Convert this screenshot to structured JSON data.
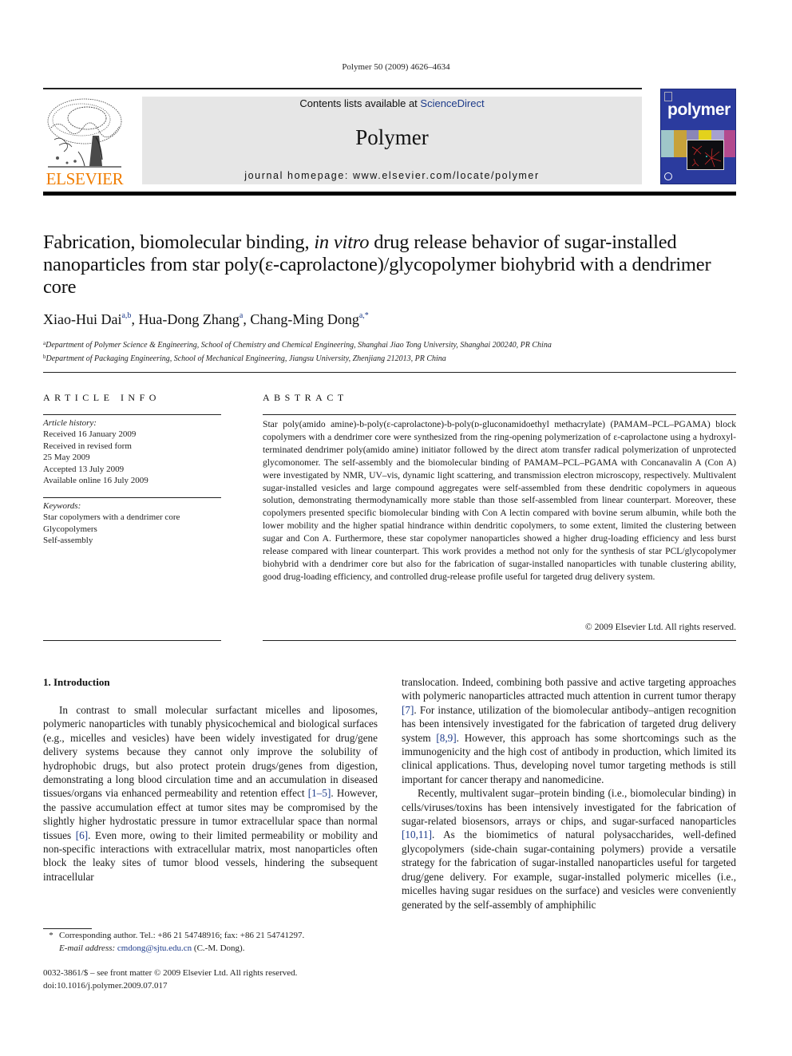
{
  "header": {
    "journal_ref": "Polymer 50 (2009) 4626–4634",
    "contents_prefix": "Contents lists available at ",
    "contents_link": "ScienceDirect",
    "journal_name": "Polymer",
    "homepage": "journal homepage: www.elsevier.com/locate/polymer",
    "publisher_wordmark": "ELSEVIER",
    "cover_title": "polymer",
    "colors": {
      "publisher_orange": "#f07d00",
      "link_blue": "#1d3b8a",
      "cover_blue": "#2b3b9e",
      "masthead_gray": "#e6e6e6"
    }
  },
  "article": {
    "title_part1": "Fabrication, biomolecular binding, ",
    "title_italic": "in vitro",
    "title_part2": " drug release behavior of sugar-installed nanoparticles from star poly(ε-caprolactone)/glycopolymer biohybrid with a dendrimer core",
    "authors": [
      {
        "name": "Xiao-Hui Dai",
        "sup": "a,b",
        "sep": ", "
      },
      {
        "name": "Hua-Dong Zhang",
        "sup": "a",
        "sep": ", "
      },
      {
        "name": "Chang-Ming Dong",
        "sup": "a,*",
        "sep": ""
      }
    ],
    "affiliations": [
      {
        "mark": "a",
        "text": "Department of Polymer Science & Engineering, School of Chemistry and Chemical Engineering, Shanghai Jiao Tong University, Shanghai 200240, PR China"
      },
      {
        "mark": "b",
        "text": "Department of Packaging Engineering, School of Mechanical Engineering, Jiangsu University, Zhenjiang 212013, PR China"
      }
    ]
  },
  "article_info": {
    "heading": "ARTICLE INFO",
    "history_label": "Article history:",
    "history": [
      "Received 16 January 2009",
      "Received in revised form",
      "25 May 2009",
      "Accepted 13 July 2009",
      "Available online 16 July 2009"
    ],
    "keywords_label": "Keywords:",
    "keywords": [
      "Star copolymers with a dendrimer core",
      "Glycopolymers",
      "Self-assembly"
    ]
  },
  "abstract": {
    "heading": "ABSTRACT",
    "body": "Star poly(amido amine)-b-poly(ε-caprolactone)-b-poly(ᴅ-gluconamidoethyl methacrylate) (PAMAM–PCL–PGAMA) block copolymers with a dendrimer core were synthesized from the ring-opening polymerization of ε-caprolactone using a hydroxyl-terminated dendrimer poly(amido amine) initiator followed by the direct atom transfer radical polymerization of unprotected glycomonomer. The self-assembly and the biomolecular binding of PAMAM–PCL–PGAMA with Concanavalin A (Con A) were investigated by NMR, UV–vis, dynamic light scattering, and transmission electron microscopy, respectively. Multivalent sugar-installed vesicles and large compound aggregates were self-assembled from these dendritic copolymers in aqueous solution, demonstrating thermodynamically more stable than those self-assembled from linear counterpart. Moreover, these copolymers presented specific biomolecular binding with Con A lectin compared with bovine serum albumin, while both the lower mobility and the higher spatial hindrance within dendritic copolymers, to some extent, limited the clustering between sugar and Con A. Furthermore, these star copolymer nanoparticles showed a higher drug-loading efficiency and less burst release compared with linear counterpart. This work provides a method not only for the synthesis of star PCL/glycopolymer biohybrid with a dendrimer core but also for the fabrication of sugar-installed nanoparticles with tunable clustering ability, good drug-loading efficiency, and controlled drug-release profile useful for targeted drug delivery system.",
    "copyright": "© 2009 Elsevier Ltd. All rights reserved."
  },
  "introduction": {
    "heading": "1.  Introduction",
    "left_p1_a": "In contrast to small molecular surfactant micelles and liposomes, polymeric nanoparticles with tunably physicochemical and biological surfaces (e.g., micelles and vesicles) have been widely investigated for drug/gene delivery systems because they cannot only improve the solubility of hydrophobic drugs, but also protect protein drugs/genes from digestion, demonstrating a long blood circulation time and an accumulation in diseased tissues/organs via enhanced permeability and retention effect ",
    "ref_1_5": "[1–5]",
    "left_p1_b": ". However, the passive accumulation effect at tumor sites may be compromised by the slightly higher hydrostatic pressure in tumor extracellular space than normal tissues ",
    "ref_6": "[6]",
    "left_p1_c": ". Even more, owing to their limited permeability or mobility and non-specific interactions with extracellular matrix, most nanoparticles often block the leaky sites of tumor blood vessels, hindering the subsequent intracellular",
    "right_p1_a": "translocation. Indeed, combining both passive and active targeting approaches with polymeric nanoparticles attracted much attention in current tumor therapy ",
    "ref_7": "[7]",
    "right_p1_b": ". For instance, utilization of the biomolecular antibody–antigen recognition has been intensively investigated for the fabrication of targeted drug delivery system ",
    "ref_8_9": "[8,9]",
    "right_p1_c": ". However, this approach has some shortcomings such as the immunogenicity and the high cost of antibody in production, which limited its clinical applications. Thus, developing novel tumor targeting methods is still important for cancer therapy and nanomedicine.",
    "right_p2_a": "Recently, multivalent sugar–protein binding (i.e., biomolecular binding) in cells/viruses/toxins has been intensively investigated for the fabrication of sugar-related biosensors, arrays or chips, and sugar-surfaced nanoparticles ",
    "ref_10_11": "[10,11]",
    "right_p2_b": ". As the biomimetics of natural polysaccharides, well-defined glycopolymers (side-chain sugar-containing polymers) provide a versatile strategy for the fabrication of sugar-installed nanoparticles useful for targeted drug/gene delivery. For example, sugar-installed polymeric micelles (i.e., micelles having sugar residues on the surface) and vesicles were conveniently generated by the self-assembly of amphiphilic"
  },
  "footnotes": {
    "star": "*",
    "corresponding": "Corresponding author. Tel.: +86 21 54748916; fax: +86 21 54741297.",
    "email_label": "E-mail address: ",
    "email": "cmdong@sjtu.edu.cn",
    "email_suffix": " (C.-M. Dong).",
    "front_matter": "0032-3861/$ – see front matter © 2009 Elsevier Ltd. All rights reserved.",
    "doi": "doi:10.1016/j.polymer.2009.07.017"
  }
}
